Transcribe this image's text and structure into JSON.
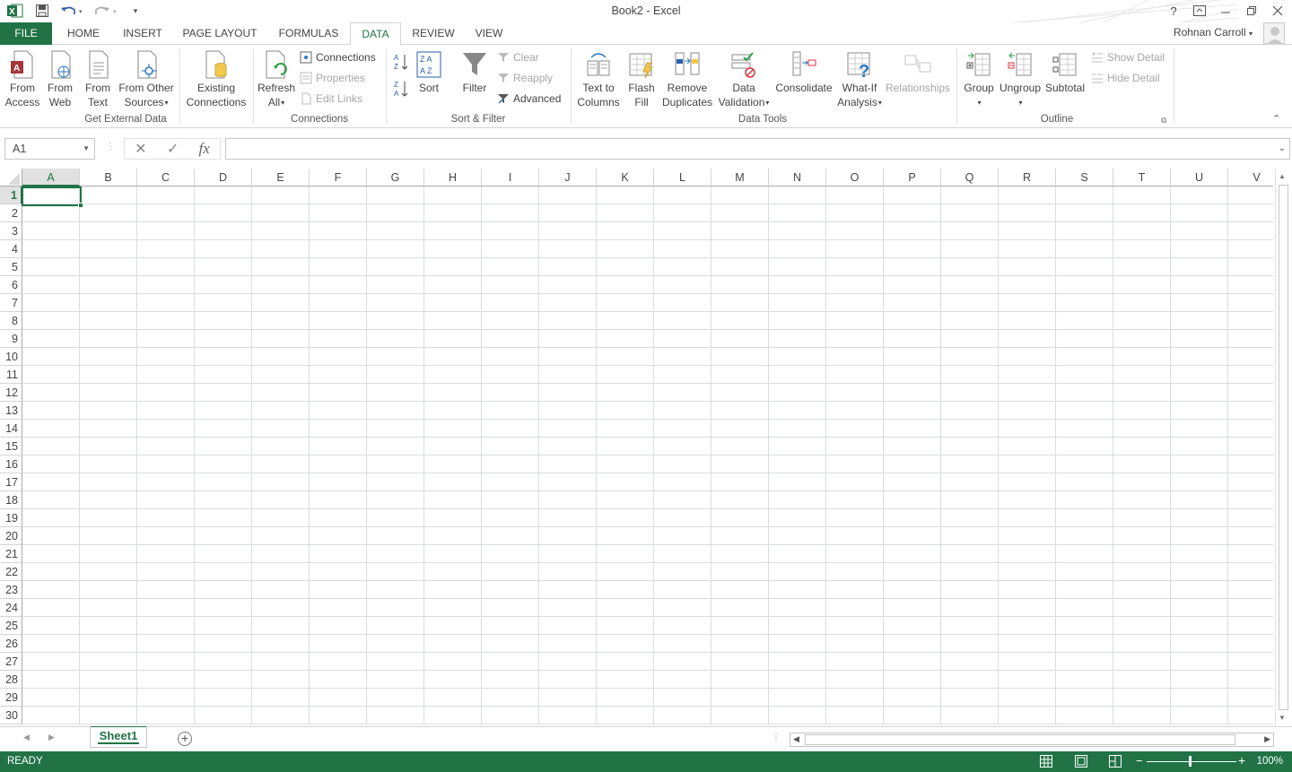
{
  "window": {
    "title": "Book2 - Excel"
  },
  "qat": {
    "undo": "undo",
    "redo": "redo"
  },
  "user": {
    "name": "Rohnan Carroll"
  },
  "tabs": [
    "FILE",
    "HOME",
    "INSERT",
    "PAGE LAYOUT",
    "FORMULAS",
    "DATA",
    "REVIEW",
    "VIEW"
  ],
  "active_tab": "DATA",
  "ribbon": {
    "get_external": {
      "label": "Get External Data",
      "from_access": [
        "From",
        "Access"
      ],
      "from_web": [
        "From",
        "Web"
      ],
      "from_text": [
        "From",
        "Text"
      ],
      "from_other": [
        "From Other",
        "Sources"
      ],
      "existing": [
        "Existing",
        "Connections"
      ]
    },
    "connections": {
      "label": "Connections",
      "refresh": [
        "Refresh",
        "All"
      ],
      "connections": "Connections",
      "properties": "Properties",
      "edit_links": "Edit Links"
    },
    "sort_filter": {
      "label": "Sort & Filter",
      "sort": "Sort",
      "filter": "Filter",
      "clear": "Clear",
      "reapply": "Reapply",
      "advanced": "Advanced"
    },
    "data_tools": {
      "label": "Data Tools",
      "text_to_columns": [
        "Text to",
        "Columns"
      ],
      "flash_fill": [
        "Flash",
        "Fill"
      ],
      "remove_duplicates": [
        "Remove",
        "Duplicates"
      ],
      "data_validation": [
        "Data",
        "Validation"
      ],
      "consolidate": "Consolidate",
      "what_if": [
        "What-If",
        "Analysis"
      ],
      "relationships": "Relationships"
    },
    "outline": {
      "label": "Outline",
      "group": "Group",
      "ungroup": "Ungroup",
      "subtotal": "Subtotal",
      "show_detail": "Show Detail",
      "hide_detail": "Hide Detail"
    }
  },
  "formula_bar": {
    "name_box": "A1",
    "fx": "fx",
    "value": ""
  },
  "grid": {
    "columns": [
      "A",
      "B",
      "C",
      "D",
      "E",
      "F",
      "G",
      "H",
      "I",
      "J",
      "K",
      "L",
      "M",
      "N",
      "O",
      "P",
      "Q",
      "R",
      "S",
      "T",
      "U",
      "V"
    ],
    "rows": [
      "1",
      "2",
      "3",
      "4",
      "5",
      "6",
      "7",
      "8",
      "9",
      "10",
      "11",
      "12",
      "13",
      "14",
      "15",
      "16",
      "17",
      "18",
      "19",
      "20",
      "21",
      "22",
      "23",
      "24",
      "25",
      "26",
      "27",
      "28",
      "29",
      "30"
    ],
    "active_cell": "A1"
  },
  "sheets": {
    "tabs": [
      "Sheet1"
    ],
    "active": "Sheet1"
  },
  "status": {
    "mode": "READY",
    "zoom": "100%"
  },
  "colors": {
    "accent": "#217346",
    "gridline": "#dadcdd"
  }
}
